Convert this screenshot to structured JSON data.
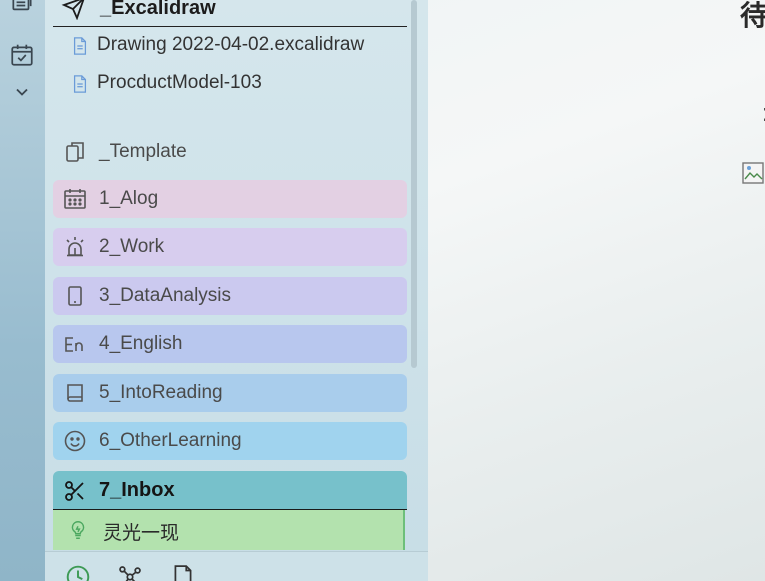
{
  "ribbon": {
    "icons": [
      "stack-icon",
      "calendar-check-icon",
      "chevron-down-icon"
    ]
  },
  "sidebar": {
    "folder": {
      "label": "_Excalidraw",
      "icon": "paper-plane-icon",
      "files": [
        {
          "label": "Drawing 2022-04-02.excalidraw",
          "icon": "file-icon"
        },
        {
          "label": "ProcductModel-103",
          "icon": "file-icon"
        }
      ]
    },
    "items": [
      {
        "label": "_Template",
        "icon": "copy-icon",
        "color": ""
      },
      {
        "label": "1_Alog",
        "icon": "calendar-icon",
        "color": "#e3d0e3"
      },
      {
        "label": "2_Work",
        "icon": "alarm-icon",
        "color": "#d7cdee"
      },
      {
        "label": "3_DataAnalysis",
        "icon": "tablet-icon",
        "color": "#cbc9ef"
      },
      {
        "label": "4_English",
        "icon": "language-en-icon",
        "color": "#b8c7ee"
      },
      {
        "label": "5_IntoReading",
        "icon": "book-icon",
        "color": "#a9cdec"
      },
      {
        "label": "6_OtherLearning",
        "icon": "smile-icon",
        "color": "#a0d3ee"
      }
    ],
    "inbox": {
      "label": "7_Inbox",
      "icon": "scissors-icon",
      "color": "#77c1cb"
    },
    "inbox_child": {
      "label": "灵光一现",
      "icon": "lightbulb-icon",
      "color": "#b3e2ae"
    }
  },
  "bottom_bar": {
    "icons": [
      "clock-icon",
      "graph-icon",
      "document-icon"
    ]
  },
  "main": {
    "title_fragment": "待",
    "colon_fragment": ":"
  }
}
